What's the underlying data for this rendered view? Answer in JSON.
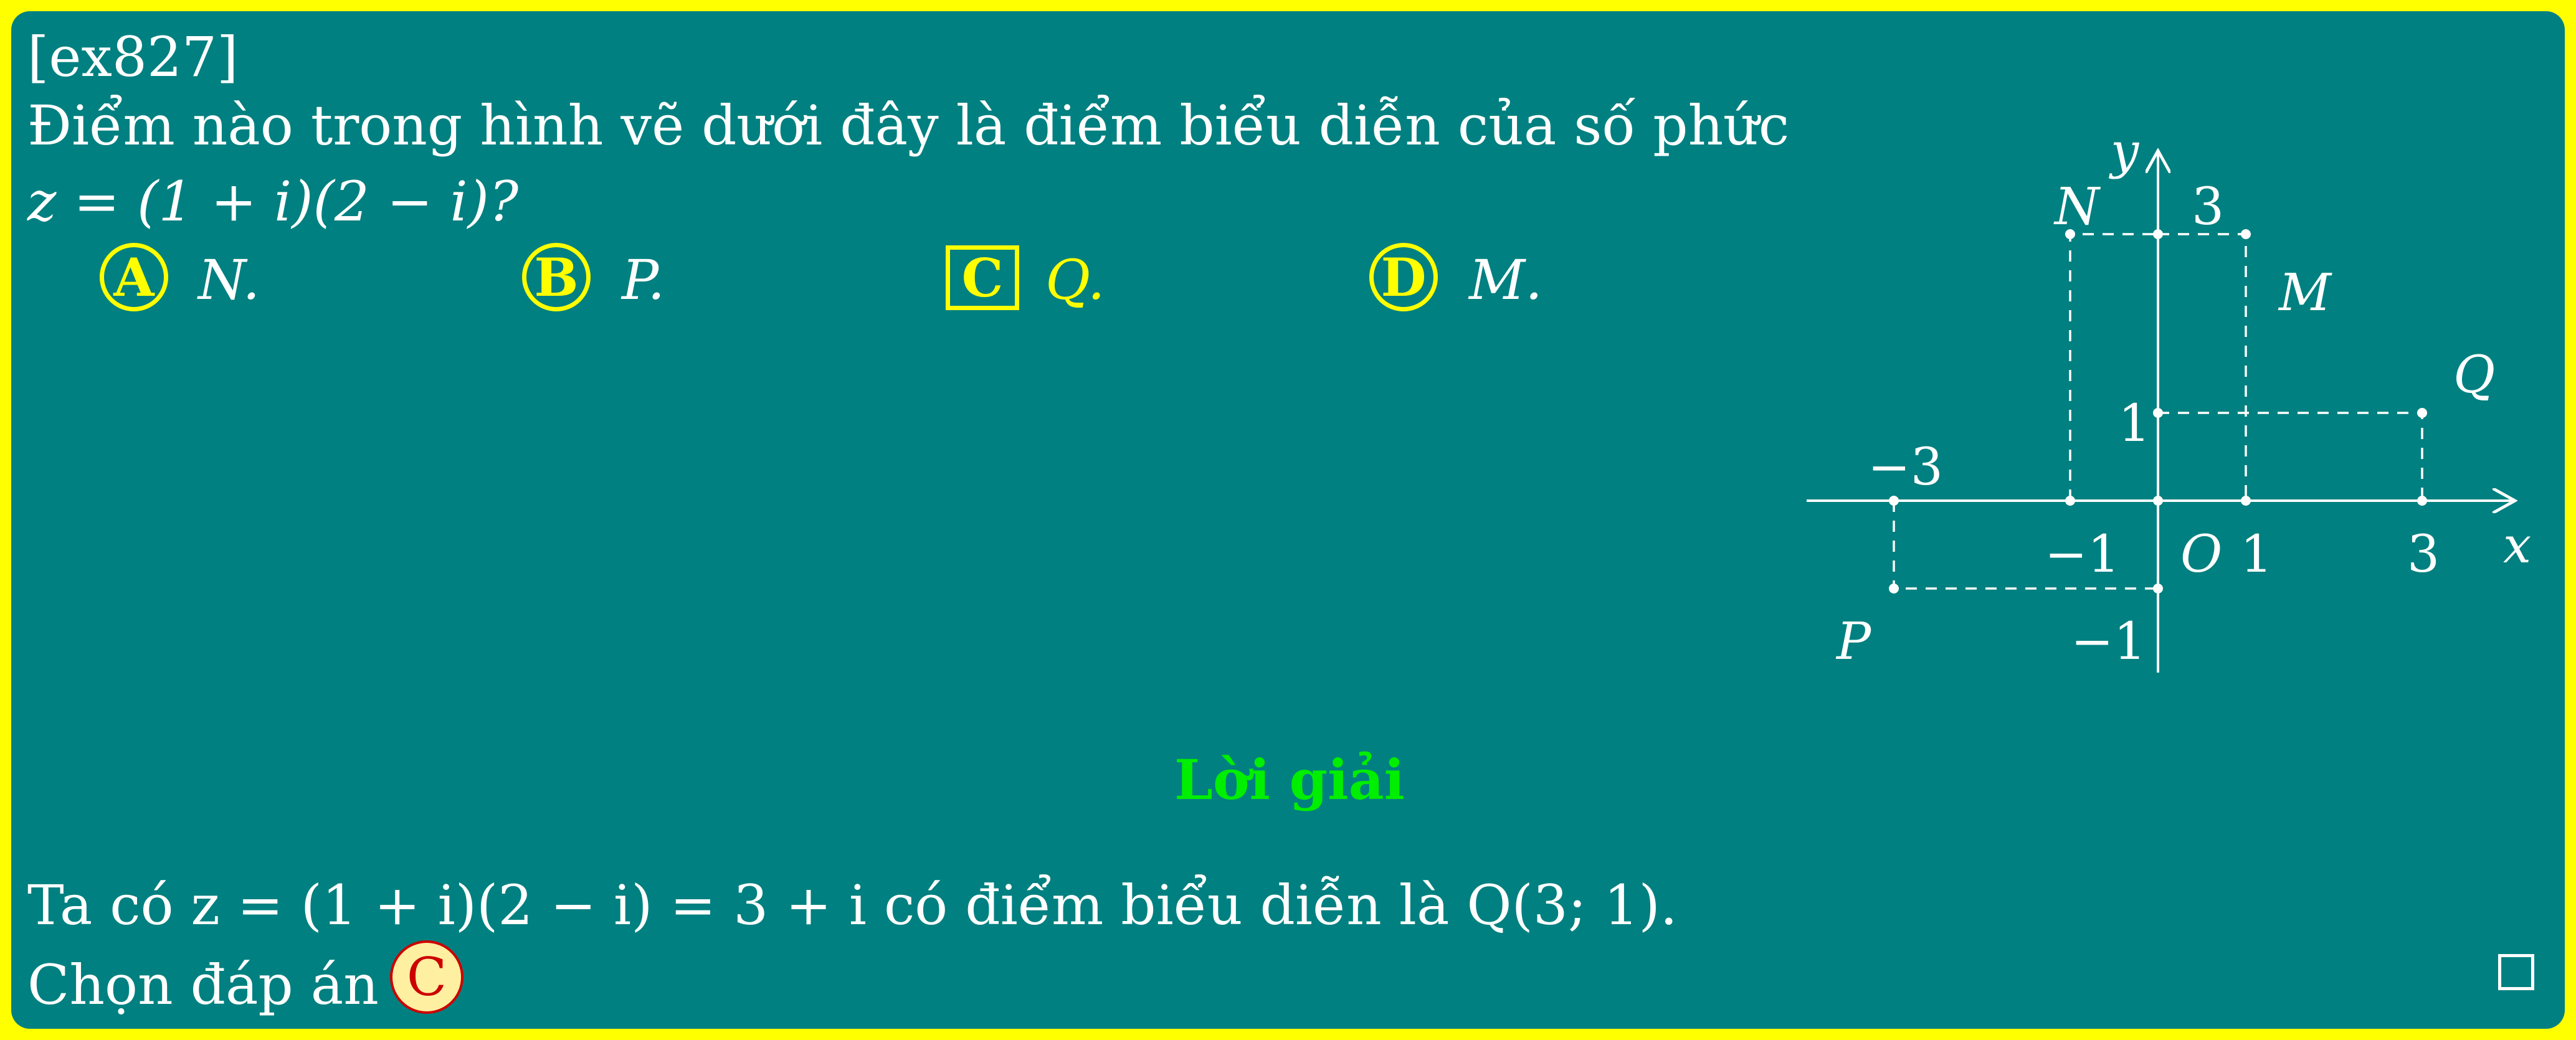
{
  "exercise_id": "[ex827]",
  "question": {
    "line1": "Điểm nào trong hình vẽ dưới đây là điểm biểu diễn của số phức",
    "line2": "z = (1 + i)(2 − i)?"
  },
  "options": [
    {
      "letter": "A",
      "value": "N.",
      "correct": false
    },
    {
      "letter": "B",
      "value": "P.",
      "correct": false
    },
    {
      "letter": "C",
      "value": "Q.",
      "correct": true
    },
    {
      "letter": "D",
      "value": "M.",
      "correct": false
    }
  ],
  "figure": {
    "axis_x": "x",
    "axis_y": "y",
    "origin": "O",
    "ticks": {
      "x_neg3": "−3",
      "x_neg1": "−1",
      "x_1": "1",
      "x_3": "3",
      "y_3": "3",
      "y_1": "1",
      "y_neg1": "−1"
    },
    "points": [
      {
        "label": "N",
        "x": -1,
        "y": 3
      },
      {
        "label": "M",
        "x": 1,
        "y": 3
      },
      {
        "label": "Q",
        "x": 3,
        "y": 1
      },
      {
        "label": "P",
        "x": -3,
        "y": -1
      }
    ]
  },
  "solution": {
    "title": "Lời giải",
    "line1": "Ta có z = (1 + i)(2 − i) = 3 + i có điểm biểu diễn là Q(3; 1).",
    "line2": "Chọn đáp án",
    "answer": "C"
  },
  "colors": {
    "background": "#008080",
    "frame": "#ffff00",
    "title": "#00ee00",
    "answer_fill": "#ffefa0",
    "answer_ring": "#cc0000"
  }
}
